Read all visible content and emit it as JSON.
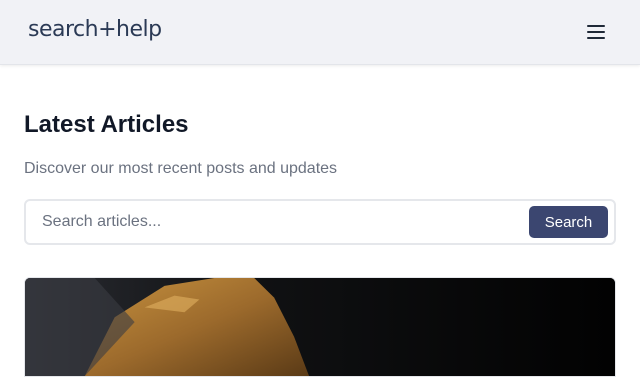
{
  "header": {
    "logo_text": "search+help",
    "menu_icon": "hamburger-menu-icon"
  },
  "main": {
    "title": "Latest Articles",
    "subtitle": "Discover our most recent posts and updates",
    "search": {
      "placeholder": "Search articles...",
      "value": "",
      "button_label": "Search"
    }
  },
  "colors": {
    "header_bg": "#f1f2f6",
    "brand_text": "#2b3a55",
    "button_bg": "#3b4670",
    "button_text": "#ffffff"
  }
}
